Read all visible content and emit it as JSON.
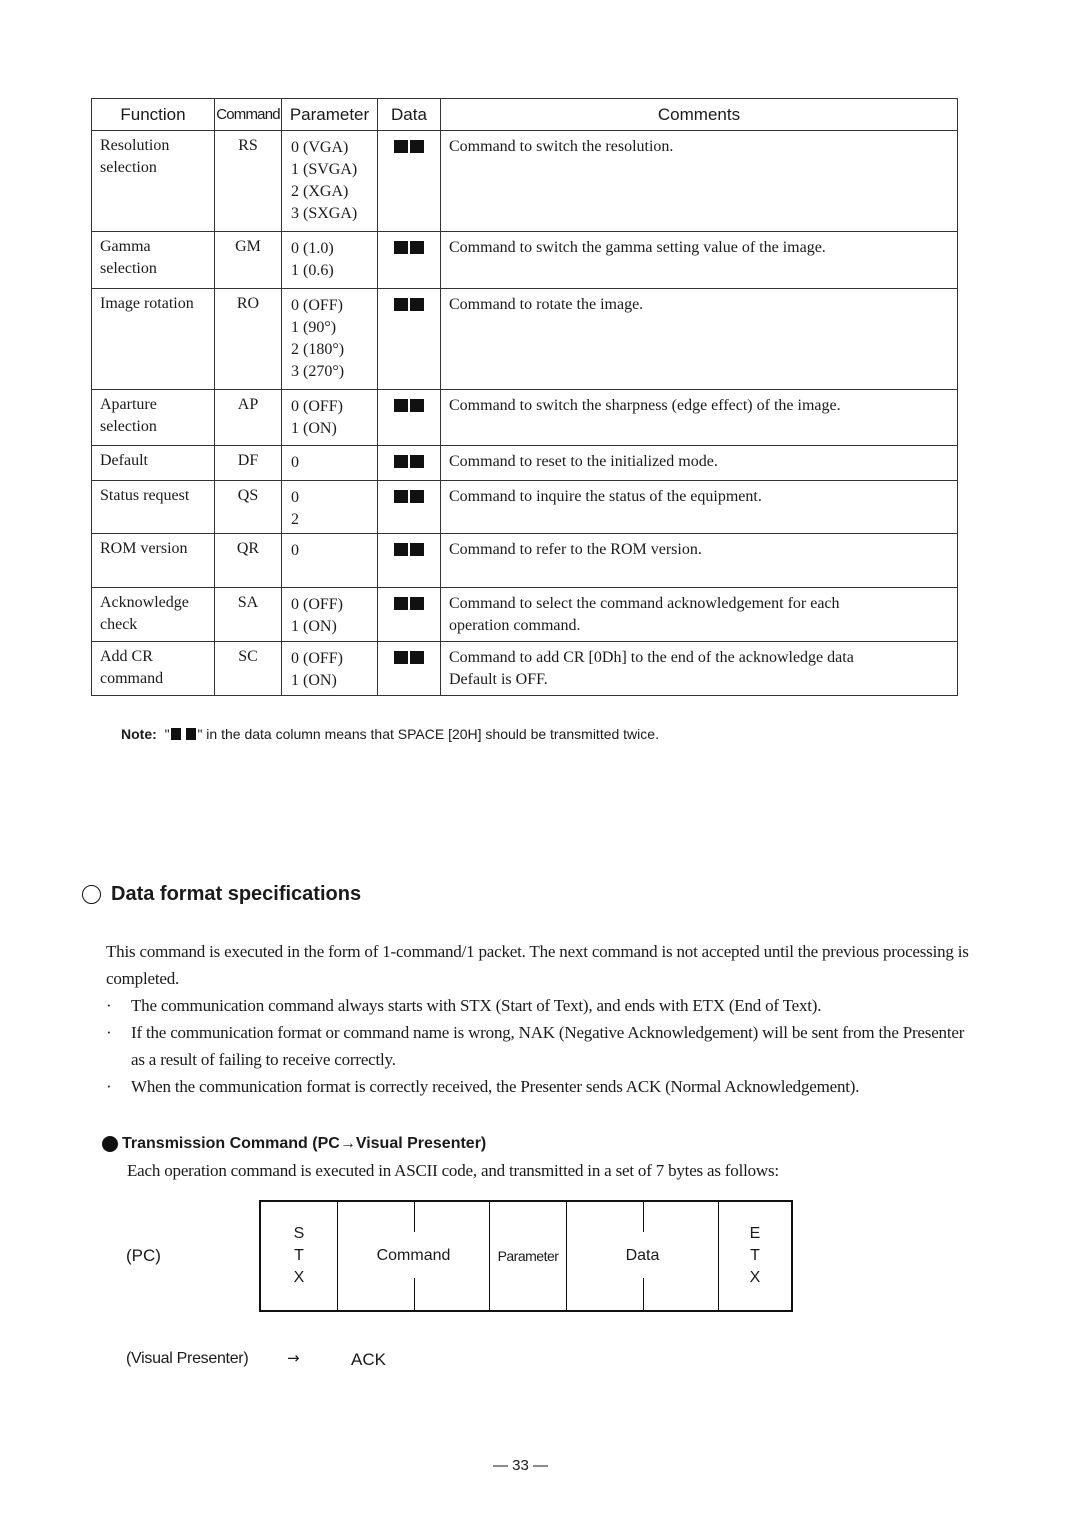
{
  "command_table": {
    "headers": {
      "function": "Function",
      "command": "Command",
      "parameter": "Parameter",
      "data": "Data",
      "comments": "Comments"
    },
    "rows": [
      {
        "function": [
          "Resolution",
          "selection"
        ],
        "command": "RS",
        "parameter": [
          "0 (VGA)",
          "1 (SVGA)",
          "2 (XGA)",
          "3 (SXGA)"
        ],
        "data": "space-space-icon",
        "comments": [
          "Command to switch the resolution."
        ]
      },
      {
        "function": [
          "Gamma",
          "selection"
        ],
        "command": "GM",
        "parameter": [
          "0 (1.0)",
          "1 (0.6)"
        ],
        "data": "space-space-icon",
        "comments": [
          "Command to switch the gamma setting value of the image."
        ]
      },
      {
        "function": [
          "Image rotation"
        ],
        "command": "RO",
        "parameter": [
          "0 (OFF)",
          "1 (90°)",
          "2 (180°)",
          "3 (270°)"
        ],
        "data": "space-space-icon",
        "comments": [
          "Command to rotate the image."
        ]
      },
      {
        "function": [
          "Aparture",
          "selection"
        ],
        "command": "AP",
        "parameter": [
          "0 (OFF)",
          "1 (ON)"
        ],
        "data": "space-space-icon",
        "comments": [
          "Command to switch the sharpness (edge effect) of the image."
        ]
      },
      {
        "function": [
          "Default"
        ],
        "command": "DF",
        "parameter": [
          "0"
        ],
        "data": "space-space-icon",
        "comments": [
          "Command to reset to the initialized mode."
        ]
      },
      {
        "function": [
          "Status request"
        ],
        "command": "QS",
        "parameter": [
          "0",
          "2"
        ],
        "data": "space-space-icon",
        "comments": [
          "Command to inquire the status of the equipment."
        ]
      },
      {
        "function": [
          "ROM version"
        ],
        "command": "QR",
        "parameter": [
          "0"
        ],
        "data": "space-space-icon",
        "comments": [
          "Command to refer to the ROM version."
        ]
      },
      {
        "function": [
          "Acknowledge",
          "check"
        ],
        "command": "SA",
        "parameter": [
          "0 (OFF)",
          "1 (ON)"
        ],
        "data": "space-space-icon",
        "comments": [
          "Command to select the command acknowledgement for each",
          "operation command."
        ]
      },
      {
        "function": [
          "Add CR",
          "command"
        ],
        "command": "SC",
        "parameter": [
          "0 (OFF)",
          "1 (ON)"
        ],
        "data": "space-space-icon",
        "comments": [
          "Command to add CR [0Dh] to the end of the acknowledge data",
          "Default is OFF."
        ]
      }
    ]
  },
  "note": {
    "label": "Note:",
    "quote_open": "\"",
    "quote_close": "\"",
    "text": " in the data column means that SPACE [20H] should be transmitted twice."
  },
  "section": {
    "title": "Data format specifications",
    "intro": "This command is executed in the form of 1-command/1 packet.  The next command is not accepted until the previous processing is completed.",
    "bullet_char": "·",
    "bullets": [
      "The communication command always starts with STX (Start of Text), and ends with ETX (End of Text).",
      "If the communication format or command name is wrong, NAK (Negative Acknowledgement) will be sent from the Presenter as a result of failing to receive correctly.",
      "When the communication format is correctly received, the Presenter sends ACK (Normal Acknowledgement)."
    ]
  },
  "transmission": {
    "title": "Transmission Command (PC→Visual Presenter)",
    "description": "Each operation command is executed in ASCII code, and transmitted in a set of 7 bytes as follows:",
    "sender_label": "(PC)",
    "packet": {
      "stx": [
        "S",
        "T",
        "X"
      ],
      "command": "Command",
      "parameter": "Parameter",
      "data": "Data",
      "etx": [
        "E",
        "T",
        "X"
      ]
    },
    "response": {
      "from_label": "(Visual Presenter)",
      "arrow": "→",
      "reply": "ACK"
    }
  },
  "footer": {
    "page_number": "— 33 —"
  }
}
